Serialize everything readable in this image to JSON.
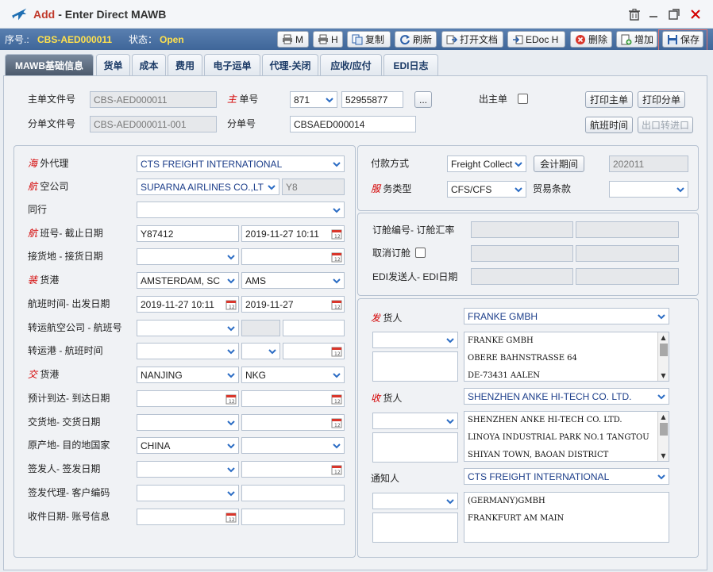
{
  "window": {
    "title_prefix": "Add",
    "title_rest": "- Enter Direct MAWB"
  },
  "header": {
    "seq_label": "序号.:",
    "seq_value": "CBS-AED000011",
    "status_label": "状态：",
    "status_value": "Open"
  },
  "toolbar": {
    "print_m": "M",
    "print_h": "H",
    "copy": "复制",
    "refresh": "刷新",
    "open_doc": "打开文档",
    "edoc_h": "EDoc H",
    "delete": "删除",
    "add": "增加",
    "save": "保存"
  },
  "tabs": [
    "MAWB基础信息",
    "货单",
    "成本",
    "费用",
    "电子运单",
    "代理-关闭",
    "应收/应付",
    "EDI日志"
  ],
  "top": {
    "master_file_label": "主单文件号",
    "master_file_value": "CBS-AED000011",
    "mawb_label_red": "主",
    "mawb_label_rest": "单号",
    "mawb_prefix": "871",
    "mawb_no": "52955877",
    "more_btn": "...",
    "out_master_label": "出主单",
    "print_master": "打印主单",
    "print_house": "打印分单",
    "house_file_label": "分单文件号",
    "house_file_value": "CBS-AED000011-001",
    "house_no_label": "分单号",
    "house_no_value": "CBSAED000014",
    "flight_time_btn": "航班时间",
    "export_transfer_btn": "出口转进口"
  },
  "left": {
    "overseas_agent_red": "海",
    "overseas_agent_rest": "外代理",
    "overseas_agent_value": "CTS FREIGHT INTERNATIONAL",
    "airline_red": "航",
    "airline_rest": "空公司",
    "airline_value": "SUPARNA AIRLINES CO.,LT",
    "airline_code": "Y8",
    "peer_label": "同行",
    "flight_red": "航",
    "flight_rest": "班号- 截止日期",
    "flight_no": "Y87412",
    "cutoff_date": "2019-11-27 10:11",
    "pickup_label": "接货地 - 接货日期",
    "load_red": "装",
    "load_rest": "货港",
    "load_port": "AMSTERDAM, SC",
    "load_code": "AMS",
    "flight_dep_label": "航班时间- 出发日期",
    "flight_time": "2019-11-27 10:11",
    "dep_date": "2019-11-27",
    "transfer_airline_label": "转运航空公司 - 航班号",
    "transfer_port_label": "转运港 - 航班时间",
    "delivery_red": "交",
    "delivery_rest": "货港",
    "delivery_port": "NANJING",
    "delivery_code": "NKG",
    "eta_label": "预计到达- 到达日期",
    "handover_label": "交货地- 交货日期",
    "origin_label": "原产地- 目的地国家",
    "origin_value": "CHINA",
    "issuer_label": "签发人- 签发日期",
    "issuing_agent_label": "签发代理- 客户编码",
    "receipt_label": "收件日期- 账号信息"
  },
  "right": {
    "payment_label": "付款方式",
    "payment_value": "Freight Collect",
    "period_btn": "会计期间",
    "period_value": "202011",
    "service_red": "服",
    "service_rest": "务类型",
    "service_value": "CFS/CFS",
    "trade_terms_label": "贸易条款",
    "booking_label": "订舱编号- 订舱汇率",
    "cancel_booking_label": "取消订舱",
    "edi_label": "EDI发送人- EDI日期",
    "shipper_red": "发",
    "shipper_rest": "货人",
    "shipper_value": "FRANKE GMBH",
    "shipper_address": [
      "FRANKE GMBH",
      "OBERE BAHNSTRASSE 64",
      "DE-73431 AALEN"
    ],
    "consignee_red": "收",
    "consignee_rest": "货人",
    "consignee_value": "SHENZHEN ANKE HI-TECH CO. LTD.",
    "consignee_address": [
      "SHENZHEN ANKE HI-TECH CO. LTD.",
      "LINOYA INDUSTRIAL PARK NO.1 TANGTOU",
      "SHIYAN TOWN, BAOAN DISTRICT"
    ],
    "notify_label": "通知人",
    "notify_value": "CTS FREIGHT INTERNATIONAL",
    "notify_address": [
      "(GERMANY)GMBH",
      "FRANKFURT AM MAIN"
    ]
  },
  "colors": {
    "accent_red": "#d40000",
    "toolbar_blue": "#4a72a6",
    "status_yellow": "#ffe14d",
    "value_blue": "#1c3e8a"
  }
}
